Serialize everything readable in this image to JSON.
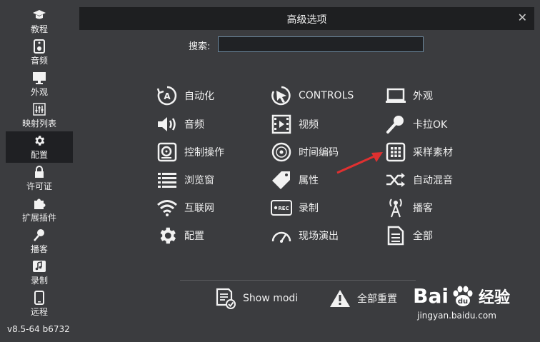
{
  "sidebar": {
    "items": [
      {
        "label": "教程",
        "icon": "graduation-cap-icon"
      },
      {
        "label": "音频",
        "icon": "speaker-icon"
      },
      {
        "label": "外观",
        "icon": "monitor-icon"
      },
      {
        "label": "映射列表",
        "icon": "sliders-icon"
      },
      {
        "label": "配置",
        "icon": "gear-icon",
        "active": true
      },
      {
        "label": "许可证",
        "icon": "lock-icon"
      },
      {
        "label": "扩展插件",
        "icon": "puzzle-icon"
      },
      {
        "label": "播客",
        "icon": "microphone-icon"
      },
      {
        "label": "录制",
        "icon": "music-note-icon"
      },
      {
        "label": "远程",
        "icon": "phone-icon"
      }
    ],
    "version": "v8.5-64 b6732"
  },
  "dialog": {
    "title": "高级选项",
    "close": "✕",
    "search_label": "搜索:",
    "search_value": ""
  },
  "options": {
    "col1": [
      {
        "label": "自动化",
        "icon": "auto-icon"
      },
      {
        "label": "音频",
        "icon": "volume-icon"
      },
      {
        "label": "控制操作",
        "icon": "turntable-icon"
      },
      {
        "label": "浏览窗",
        "icon": "list-icon"
      },
      {
        "label": "互联网",
        "icon": "wifi-icon"
      },
      {
        "label": "配置",
        "icon": "gear-icon"
      }
    ],
    "col2": [
      {
        "label": "CONTROLS",
        "icon": "cursor-icon"
      },
      {
        "label": "视频",
        "icon": "film-icon"
      },
      {
        "label": "时间编码",
        "icon": "vinyl-icon"
      },
      {
        "label": "属性",
        "icon": "tag-icon"
      },
      {
        "label": "录制",
        "icon": "rec-icon"
      },
      {
        "label": "现场演出",
        "icon": "gauge-icon"
      }
    ],
    "col3": [
      {
        "label": "外观",
        "icon": "laptop-icon"
      },
      {
        "label": "卡拉OK",
        "icon": "microphone-icon"
      },
      {
        "label": "采样素材",
        "icon": "grid-icon"
      },
      {
        "label": "自动混音",
        "icon": "shuffle-icon"
      },
      {
        "label": "播客",
        "icon": "antenna-icon"
      },
      {
        "label": "全部",
        "icon": "document-icon"
      }
    ]
  },
  "bottom": {
    "show_label": "Show modi",
    "reset_label": "全部重置"
  },
  "watermark": {
    "bai": "Bai",
    "cn": "经验",
    "url": "jingyan.baidu.com"
  },
  "colors": {
    "background": "#3b3c3f",
    "titlebar": "#1e1f21",
    "arrow": "#e03030"
  }
}
